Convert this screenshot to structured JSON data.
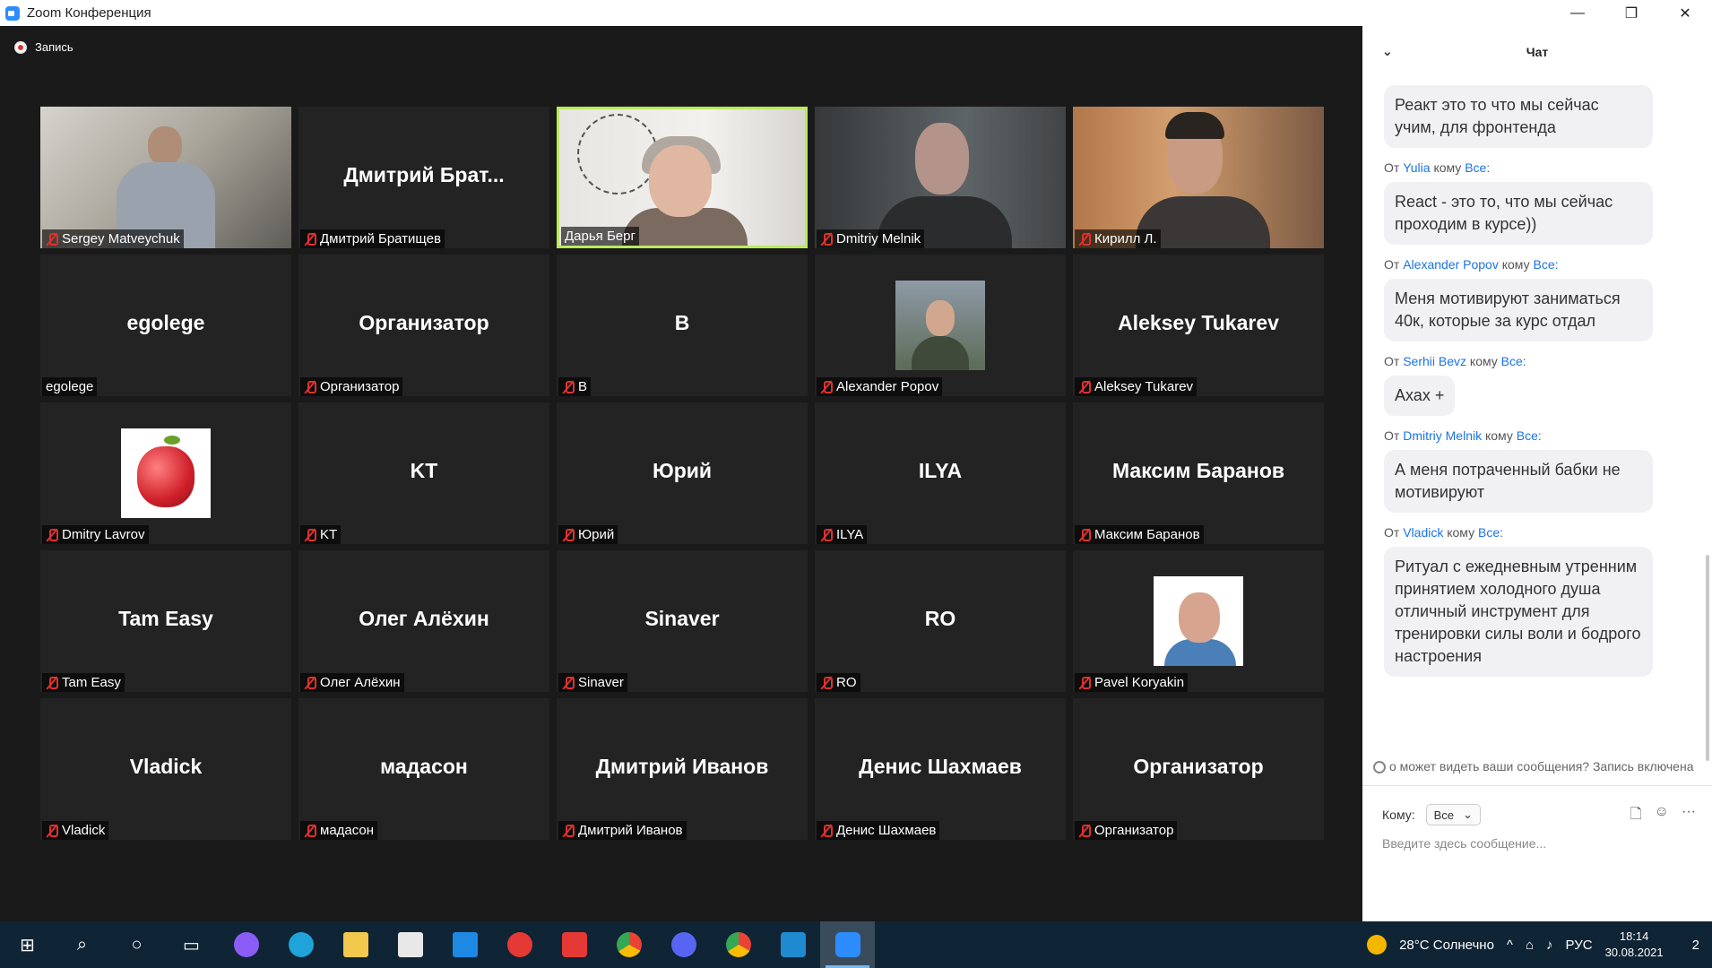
{
  "window": {
    "title": "Zoom Конференция",
    "minimize": "—",
    "maximize": "❐",
    "close": "✕"
  },
  "recording": {
    "label": "Запись"
  },
  "tiles": [
    {
      "big": "",
      "name": "Sergey Matveychuk",
      "muted": true
    },
    {
      "big": "Дмитрий Брат...",
      "name": "Дмитрий Братищев",
      "muted": true
    },
    {
      "big": "",
      "name": "Дарья Берг",
      "muted": false
    },
    {
      "big": "",
      "name": "Dmitriy Melnik",
      "muted": true
    },
    {
      "big": "",
      "name": "Кирилл Л.",
      "muted": true
    },
    {
      "big": "egolege",
      "name": "egolege",
      "muted": false
    },
    {
      "big": "Организатор",
      "name": "Организатор",
      "muted": true
    },
    {
      "big": "B",
      "name": "B",
      "muted": true
    },
    {
      "big": "",
      "name": "Alexander Popov",
      "muted": true
    },
    {
      "big": "Aleksey Tukarev",
      "name": "Aleksey Tukarev",
      "muted": true
    },
    {
      "big": "",
      "name": "Dmitry Lavrov",
      "muted": true
    },
    {
      "big": "KT",
      "name": "KT",
      "muted": true
    },
    {
      "big": "Юрий",
      "name": "Юрий",
      "muted": true
    },
    {
      "big": "ILYA",
      "name": "ILYA",
      "muted": true
    },
    {
      "big": "Максим Баранов",
      "name": "Максим Баранов",
      "muted": true
    },
    {
      "big": "Tam Easy",
      "name": "Tam Easy",
      "muted": true
    },
    {
      "big": "Олег Алёхин",
      "name": "Олег Алёхин",
      "muted": true
    },
    {
      "big": "Sinaver",
      "name": "Sinaver",
      "muted": true
    },
    {
      "big": "RO",
      "name": "RO",
      "muted": true
    },
    {
      "big": "",
      "name": "Pavel Koryakin",
      "muted": true
    },
    {
      "big": "Vladick",
      "name": "Vladick",
      "muted": true
    },
    {
      "big": "мадасон",
      "name": "мадасон",
      "muted": true
    },
    {
      "big": "Дмитрий Иванов",
      "name": "Дмитрий Иванов",
      "muted": true
    },
    {
      "big": "Денис Шахмаев",
      "name": "Денис Шахмаев",
      "muted": true
    },
    {
      "big": "Организатор",
      "name": "Организатор",
      "muted": true
    }
  ],
  "chat": {
    "title": "Чат",
    "from_word": "От",
    "to_word": "кому",
    "everyone": "Все:",
    "messages": [
      {
        "from": "",
        "text": "Реакт это то что мы сейчас учим, для фронтенда"
      },
      {
        "from": "Yulia",
        "text": "React  - это то, что мы сейчас проходим в курсе))"
      },
      {
        "from": "Alexander Popov",
        "text": "Меня мотивируют заниматься 40к, которые за курс отдал"
      },
      {
        "from": "Serhii Bevz",
        "text": "Ахах +"
      },
      {
        "from": "Dmitriy Melnik",
        "text": "А меня потраченный бабки не мотивируют"
      },
      {
        "from": "Vladick",
        "text": "Ритуал с ежедневным утренним принятием холодного душа отличный инструмент для тренировки силы воли и бодрого настроения"
      }
    ],
    "notice": "о может видеть ваши сообщения? Запись включена",
    "to_label": "Кому:",
    "to_value": "Все",
    "input_placeholder": "Введите здесь сообщение..."
  },
  "taskbar": {
    "weather": "28°C Солнечно",
    "lang": "РУС",
    "time": "18:14",
    "date": "30.08.2021",
    "notifications": "2"
  }
}
